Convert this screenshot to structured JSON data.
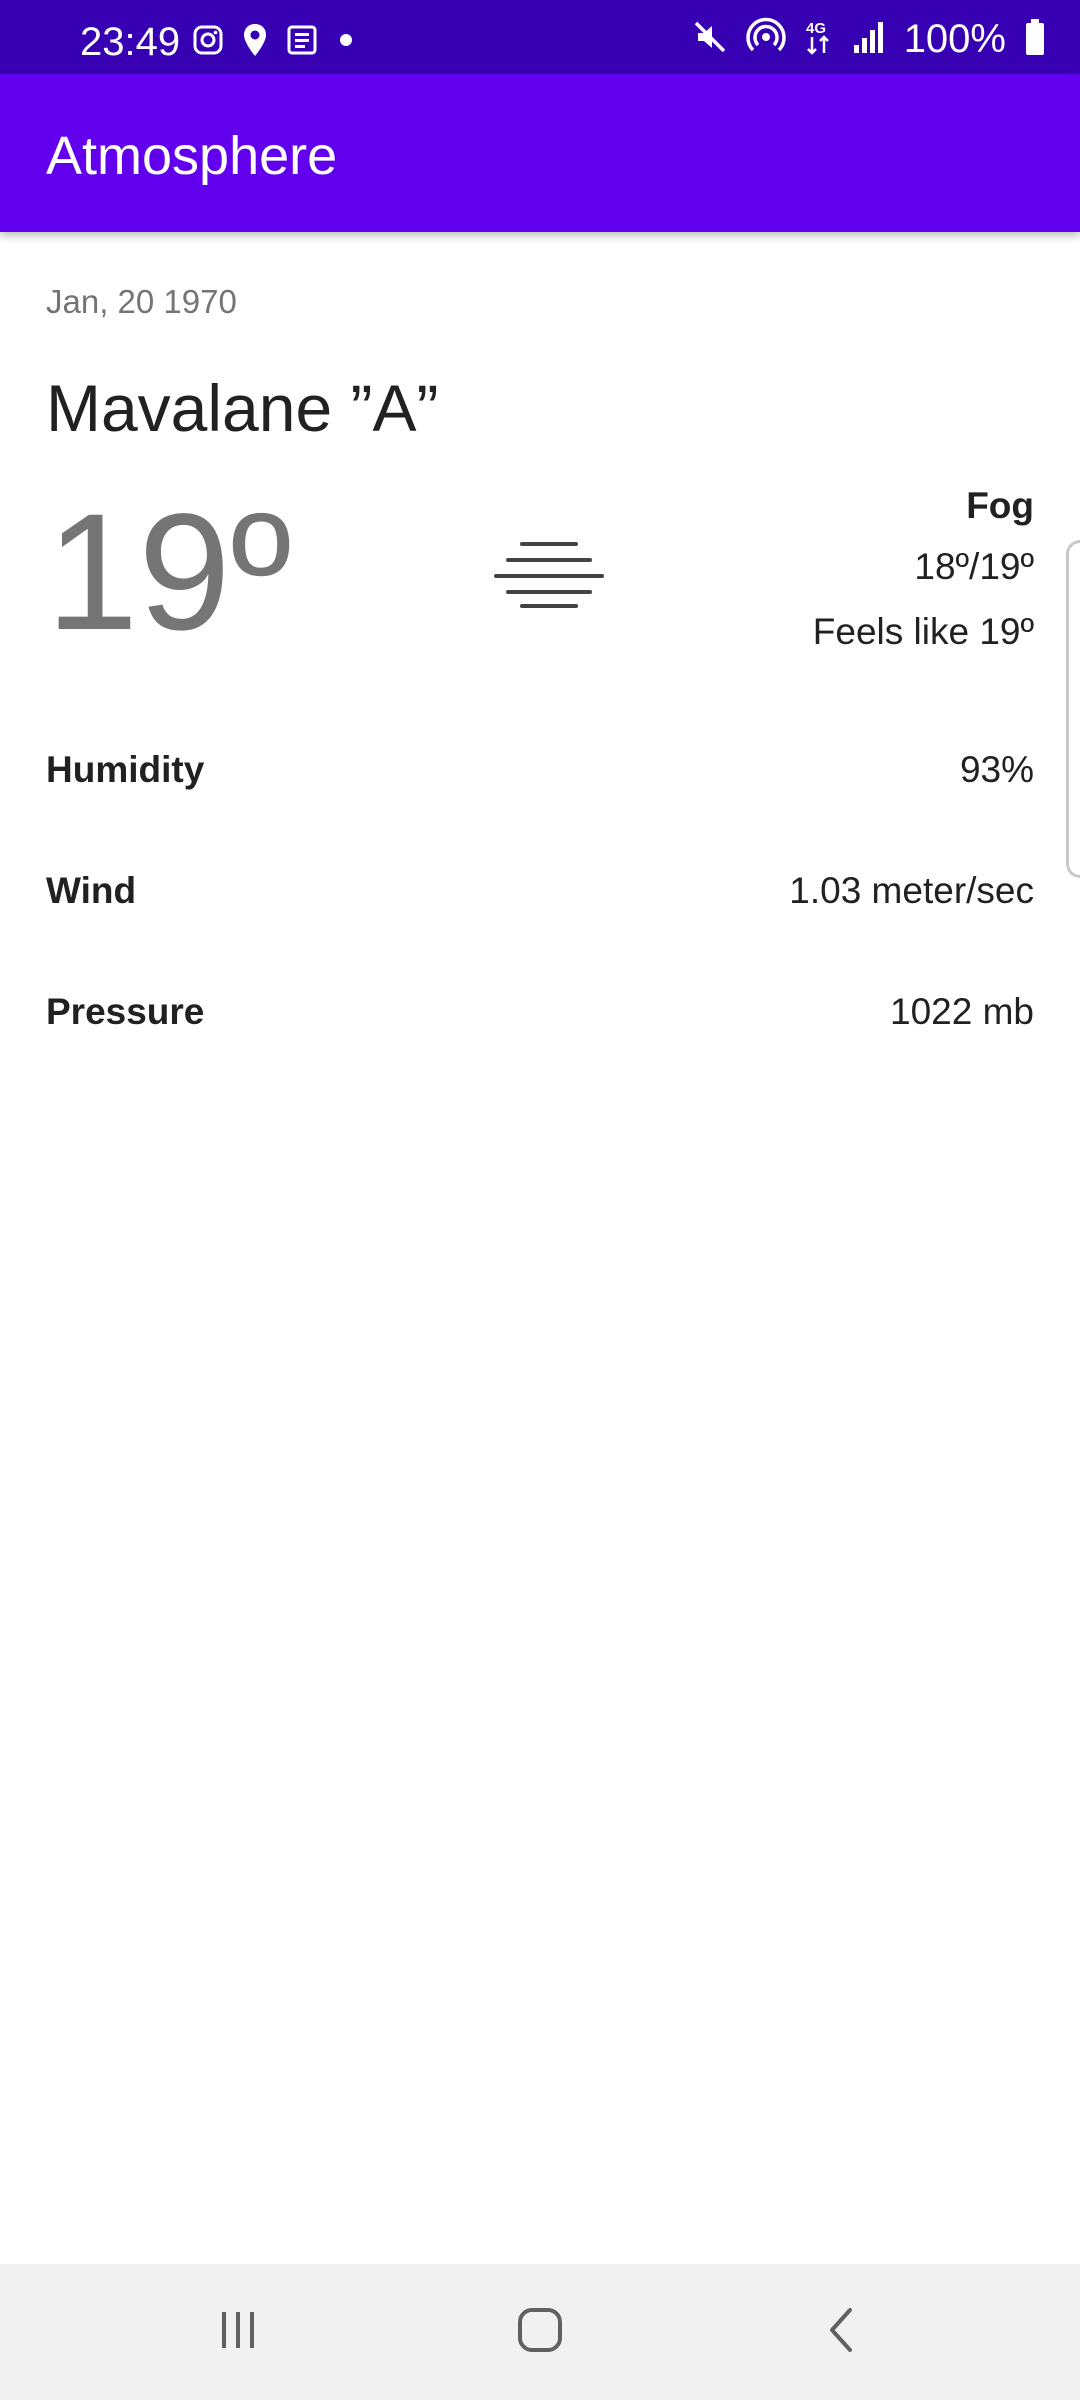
{
  "status_bar": {
    "time": "23:49",
    "battery": "100%",
    "left_icons": [
      "instagram-icon",
      "location-pin-icon",
      "news-icon",
      "dot-icon"
    ],
    "right_icons": [
      "mute-icon",
      "hotspot-icon",
      "4g-data-icon",
      "signal-icon",
      "battery-icon"
    ]
  },
  "app_bar": {
    "title": "Atmosphere"
  },
  "weather": {
    "date": "Jan, 20 1970",
    "location": "Mavalane ”A”",
    "temperature": "19º",
    "condition": "Fog",
    "min_max": "18º/19º",
    "feels_like": "Feels like 19º",
    "icon": "fog-icon"
  },
  "details": [
    {
      "label": "Humidity",
      "value": "93%"
    },
    {
      "label": "Wind",
      "value": "1.03 meter/sec"
    },
    {
      "label": "Pressure",
      "value": "1022 mb"
    }
  ],
  "nav_bar": {
    "buttons": [
      "recent-apps-icon",
      "home-icon",
      "back-icon"
    ]
  },
  "colors": {
    "status_bar": "#3700b3",
    "app_bar": "#6200ee",
    "nav_bar": "#f1f1f1",
    "primary_text": "#212121",
    "secondary_text": "#757575"
  }
}
